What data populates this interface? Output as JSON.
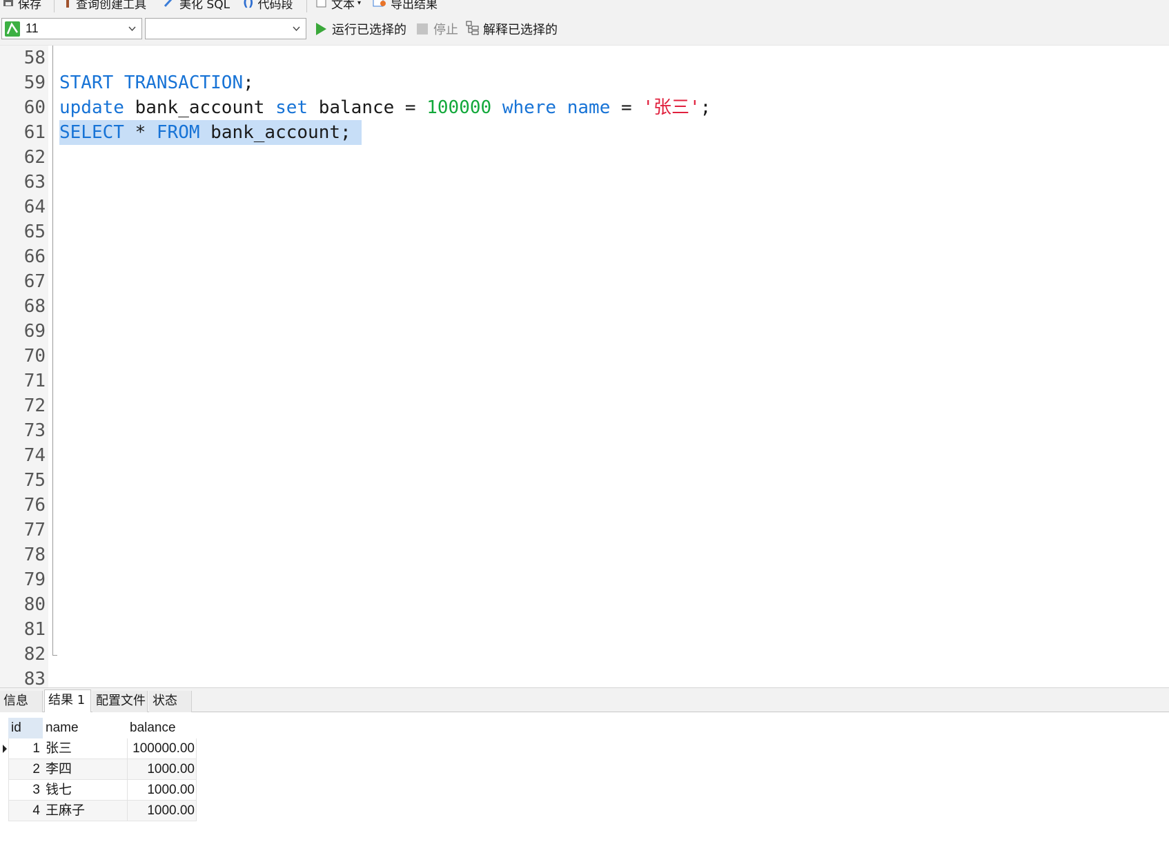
{
  "toolbar_top": {
    "save_label": "保存",
    "query_builder_label": "查询创建工具",
    "beautify_label": "美化 SQL",
    "snippet_label": "代码段",
    "text_label": "文本",
    "export_label": "导出结果"
  },
  "toolbar_run": {
    "connection_value": "11",
    "database_value": "",
    "run_selected_label": "运行已选择的",
    "stop_label": "停止",
    "explain_selected_label": "解释已选择的"
  },
  "editor": {
    "line_numbers": [
      "58",
      "59",
      "60",
      "61",
      "62",
      "63",
      "64",
      "65",
      "66",
      "67",
      "68",
      "69",
      "70",
      "71",
      "72",
      "73",
      "74",
      "75",
      "76",
      "77",
      "78",
      "79",
      "80",
      "81",
      "82",
      "83"
    ],
    "lines": [
      {
        "line": "59",
        "text": "START TRANSACTION;"
      },
      {
        "line": "60",
        "text": "update bank_account set balance = 100000 where name = '张三';"
      },
      {
        "line": "61",
        "text": "SELECT * FROM bank_account;"
      }
    ],
    "colors": {
      "keyword": "#1773d6",
      "number": "#11a83a",
      "string": "#e0203d",
      "selection": "#c7def7"
    }
  },
  "result_tabs": [
    "信息",
    "结果 1",
    "配置文件",
    "状态"
  ],
  "active_tab": "结果 1",
  "result_grid": {
    "columns": [
      "id",
      "name",
      "balance"
    ],
    "rows": [
      {
        "id": "1",
        "name": "张三",
        "balance": "100000.00"
      },
      {
        "id": "2",
        "name": "李四",
        "balance": "1000.00"
      },
      {
        "id": "3",
        "name": "钱七",
        "balance": "1000.00"
      },
      {
        "id": "4",
        "name": "王麻子",
        "balance": "1000.00"
      }
    ]
  }
}
